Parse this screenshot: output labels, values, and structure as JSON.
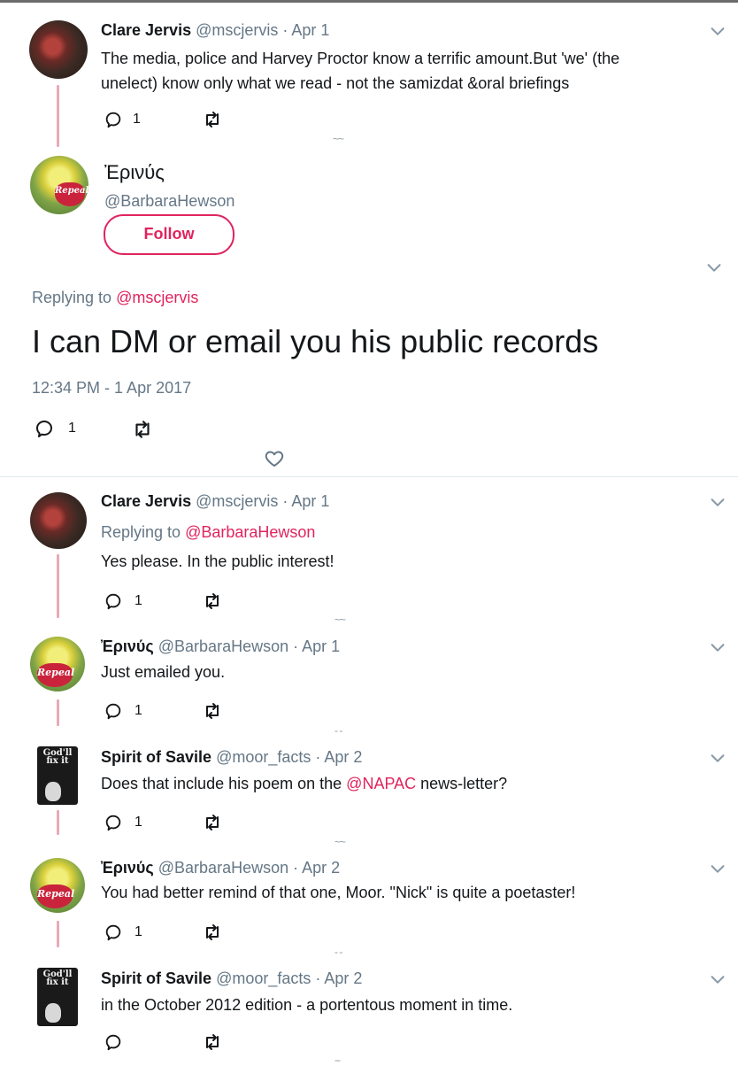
{
  "colors": {
    "link": "#e0245e",
    "meta": "#657786",
    "thread_line": "#e8aab6"
  },
  "tweet1": {
    "name": "Clare Jervis",
    "handle": "@mscjervis",
    "date": "· Apr 1",
    "line1": "The media, police and Harvey Proctor know a terrific amount.But 'we' (the",
    "line2": "unelect) know only what we read - not the samizdat &oral briefings",
    "reply_count": "1"
  },
  "main": {
    "name": "Ἐρινύς",
    "handle": "@BarbaraHewson",
    "follow_label": "Follow",
    "replying_prefix": "Replying to",
    "replying_to": "@mscjervis",
    "text": "I can DM or email you his public records",
    "timestamp": "12:34 PM - 1 Apr 2017",
    "reply_count": "1",
    "badge_text": "Repeal"
  },
  "replies": [
    {
      "name": "Clare Jervis",
      "handle": "@mscjervis",
      "date": "· Apr 1",
      "replying_prefix": "Replying to",
      "replying_to": "@BarbaraHewson",
      "text": "Yes please. In the public interest!",
      "reply_count": "1"
    },
    {
      "name": "Ἐρινύς",
      "handle": "@BarbaraHewson",
      "date": "· Apr 1",
      "text": "Just emailed you.",
      "reply_count": "1"
    },
    {
      "name": "Spirit of Savile",
      "handle": "@moor_facts",
      "date": "· Apr 2",
      "text_before": "Does that include his poem on the ",
      "mention": "@NAPAC",
      "text_after": " news-letter?",
      "reply_count": "1",
      "avatar_text": "God'll fix it"
    },
    {
      "name": "Ἐρινύς",
      "handle": "@BarbaraHewson",
      "date": "· Apr 2",
      "text": "You had better remind of that one, Moor. \"Nick\" is quite a poetaster!",
      "reply_count": "1"
    },
    {
      "name": "Spirit of Savile",
      "handle": "@moor_facts",
      "date": "· Apr 2",
      "text": "in the October 2012 edition - a portentous moment in time.",
      "reply_count": "",
      "avatar_text": "God'll fix it"
    }
  ],
  "icons": [
    "reply-icon",
    "retweet-icon",
    "like-icon",
    "chevron-down-icon",
    "more-dots-icon"
  ]
}
